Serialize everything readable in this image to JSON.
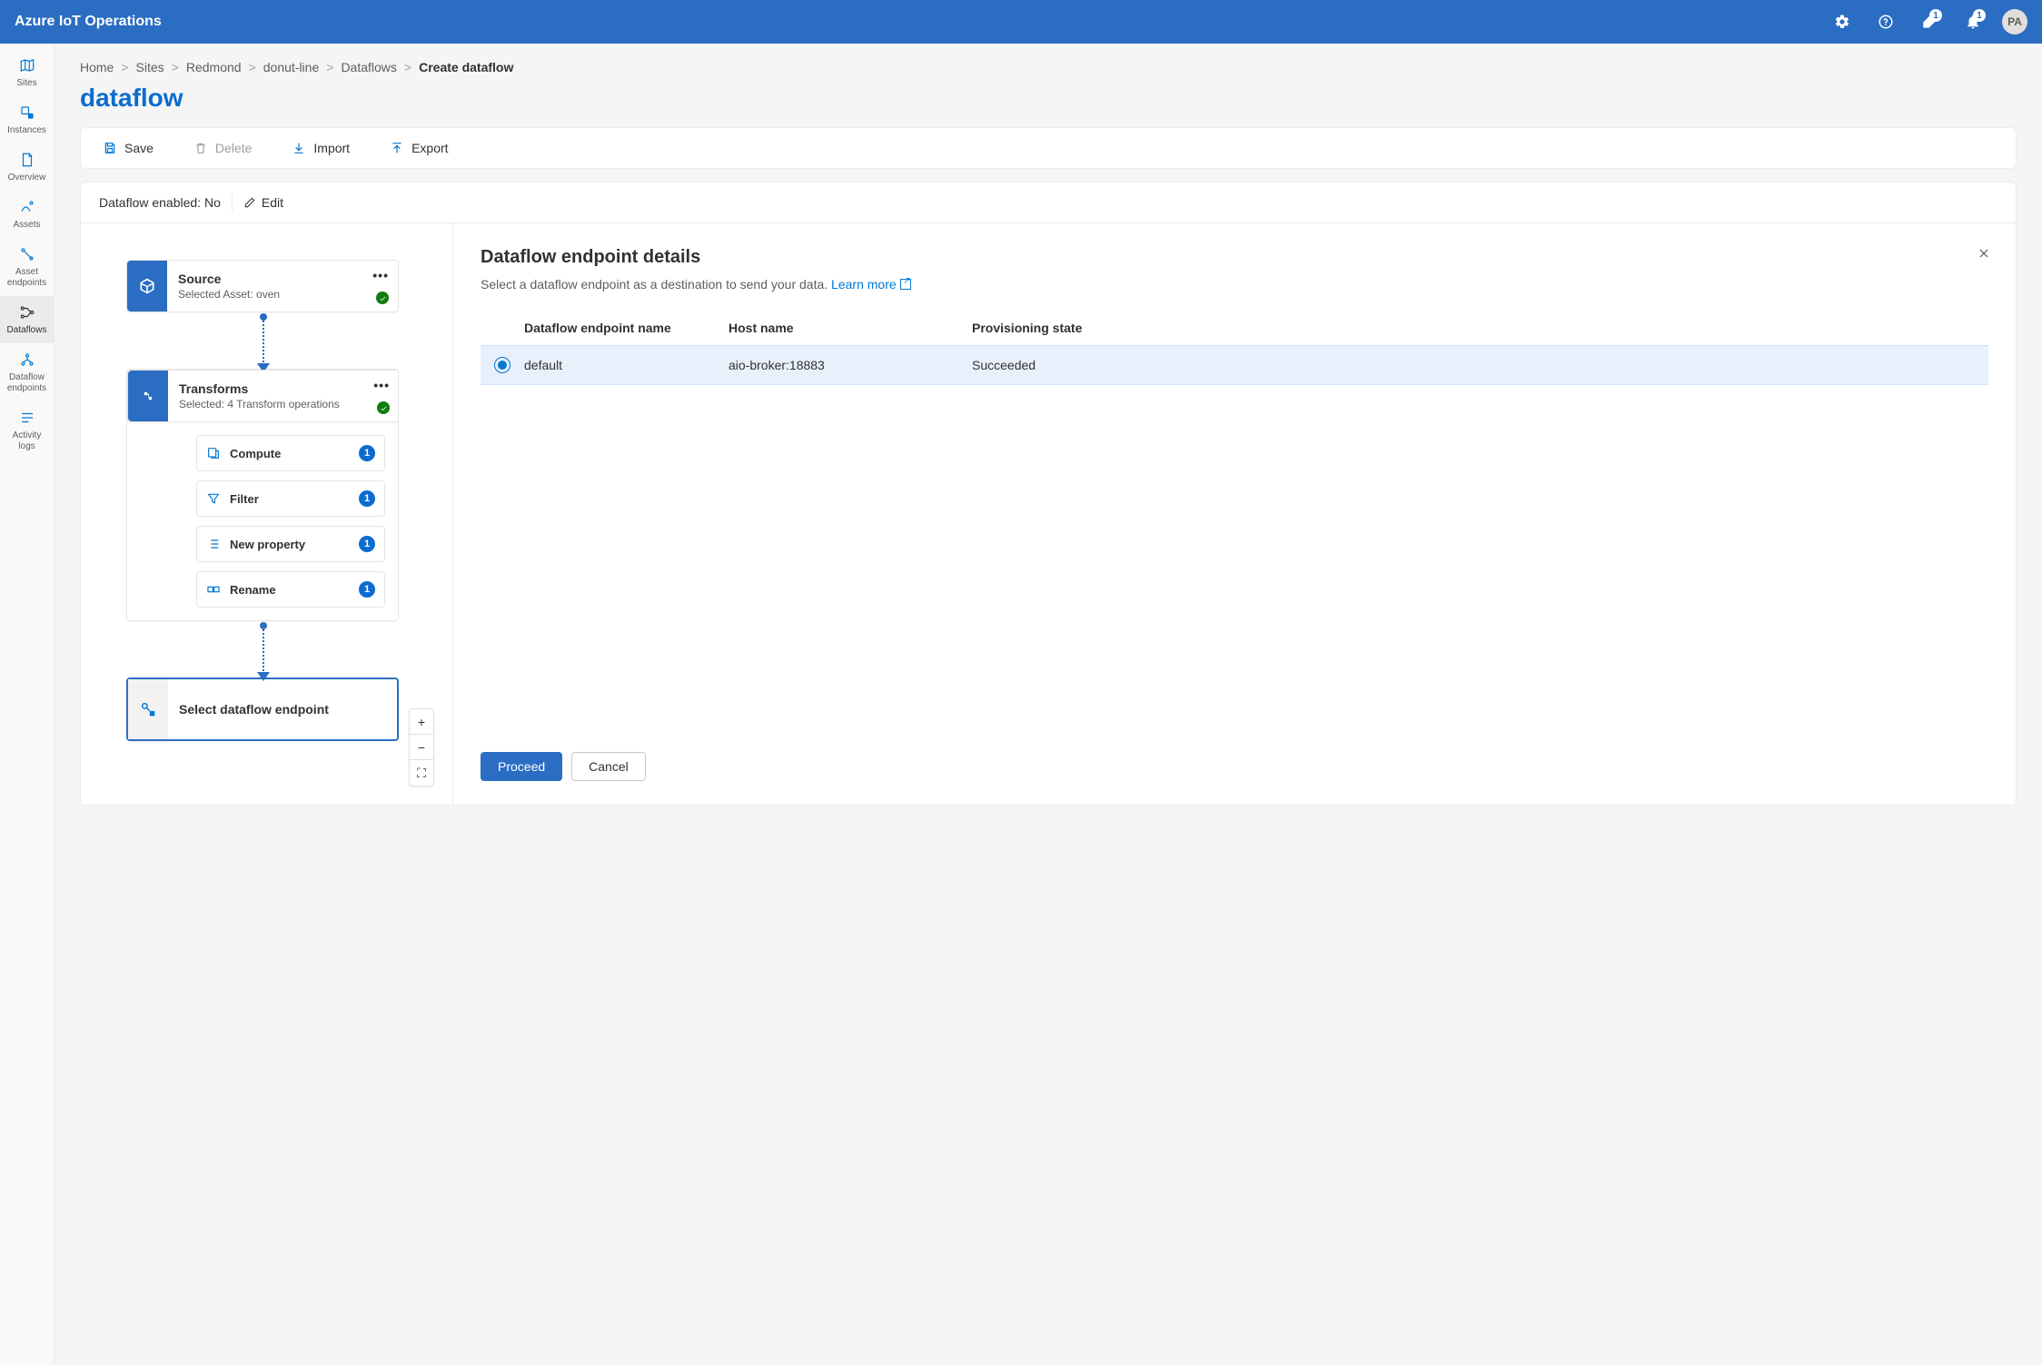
{
  "topbar": {
    "title": "Azure IoT Operations",
    "badge1": "1",
    "badge2": "1",
    "avatar": "PA"
  },
  "sidenav": {
    "items": [
      {
        "label": "Sites"
      },
      {
        "label": "Instances"
      },
      {
        "label": "Overview"
      },
      {
        "label": "Assets"
      },
      {
        "label": "Asset endpoints"
      },
      {
        "label": "Dataflows"
      },
      {
        "label": "Dataflow endpoints"
      },
      {
        "label": "Activity logs"
      }
    ]
  },
  "breadcrumbs": {
    "items": [
      {
        "label": "Home"
      },
      {
        "label": "Sites"
      },
      {
        "label": "Redmond"
      },
      {
        "label": "donut-line"
      },
      {
        "label": "Dataflows"
      }
    ],
    "current": "Create dataflow"
  },
  "page_title": "dataflow",
  "commands": {
    "save": "Save",
    "delete": "Delete",
    "import": "Import",
    "export": "Export"
  },
  "enabled_bar": {
    "label": "Dataflow enabled:",
    "value": "No",
    "edit": "Edit"
  },
  "canvas": {
    "source": {
      "title": "Source",
      "subtitle": "Selected Asset: oven"
    },
    "transforms": {
      "title": "Transforms",
      "subtitle": "Selected: 4 Transform operations",
      "ops": [
        {
          "label": "Compute",
          "count": "1"
        },
        {
          "label": "Filter",
          "count": "1"
        },
        {
          "label": "New property",
          "count": "1"
        },
        {
          "label": "Rename",
          "count": "1"
        }
      ]
    },
    "dest": {
      "label": "Select dataflow endpoint"
    }
  },
  "details": {
    "title": "Dataflow endpoint details",
    "subtitle": "Select a dataflow endpoint as a destination to send your data.",
    "learn_more": "Learn more",
    "headers": {
      "name": "Dataflow endpoint name",
      "host": "Host name",
      "state": "Provisioning state"
    },
    "rows": [
      {
        "name": "default",
        "host": "aio-broker:18883",
        "state": "Succeeded"
      }
    ],
    "proceed": "Proceed",
    "cancel": "Cancel"
  }
}
